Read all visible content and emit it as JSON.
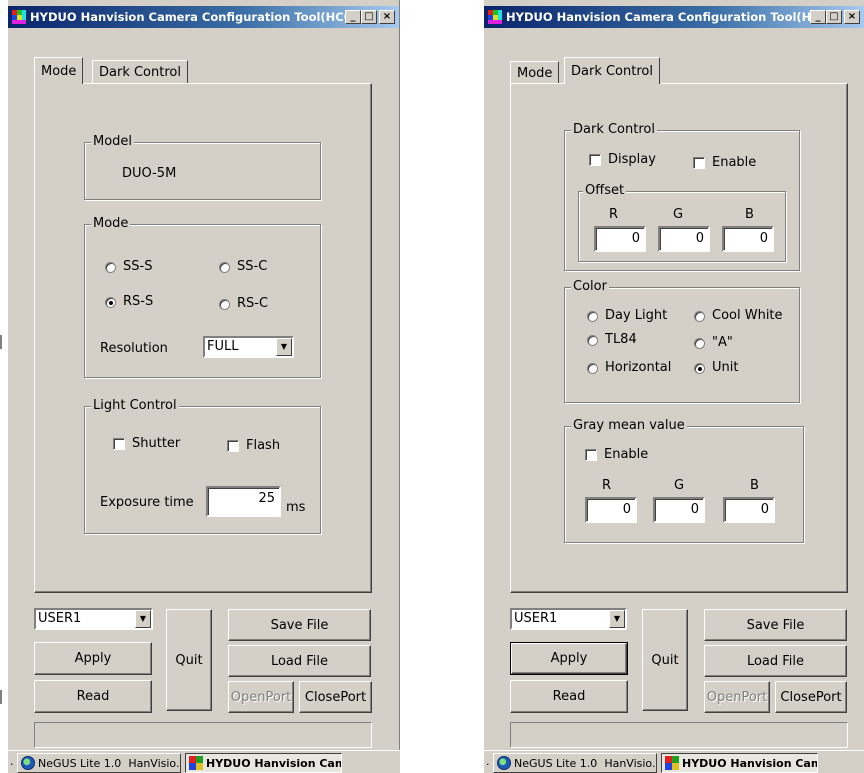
{
  "left": {
    "title": "HYDUO Hanvision Camera Configuration Tool(HCCT)",
    "tabs": [
      "Mode",
      "Dark Control"
    ],
    "model": {
      "group_title": "Model",
      "value": "DUO-5M"
    },
    "mode": {
      "group_title": "Mode",
      "options": [
        "SS-S",
        "SS-C",
        "RS-S",
        "RS-C"
      ],
      "selected": "RS-S",
      "resolution_label": "Resolution",
      "resolution_value": "FULL"
    },
    "light": {
      "group_title": "Light Control",
      "shutter_label": "Shutter",
      "flash_label": "Flash",
      "exposure_label": "Exposure time",
      "exposure_value": "25",
      "exposure_unit": "ms"
    }
  },
  "right": {
    "title": "HYDUO Hanvision Camera Configuration Tool(HCCT)",
    "tabs": [
      "Mode",
      "Dark Control"
    ],
    "dark": {
      "group_title": "Dark Control",
      "display_label": "Display",
      "enable_label": "Enable",
      "offset_title": "Offset",
      "r_label": "R",
      "g_label": "G",
      "b_label": "B",
      "r_value": "0",
      "g_value": "0",
      "b_value": "0"
    },
    "color": {
      "group_title": "Color",
      "options": [
        "Day Light",
        "Cool White",
        "TL84",
        "\"A\"",
        "Horizontal",
        "Unit"
      ],
      "selected": "Unit"
    },
    "gray": {
      "group_title": "Gray mean value",
      "enable_label": "Enable",
      "r_label": "R",
      "g_label": "G",
      "b_label": "B",
      "r_value": "0",
      "g_value": "0",
      "b_value": "0"
    }
  },
  "bottom": {
    "user_select": "USER1",
    "apply": "Apply",
    "read": "Read",
    "quit": "Quit",
    "save_file": "Save File",
    "load_file": "Load File",
    "open_port": "OpenPort",
    "close_port": "ClosePort"
  },
  "taskbar": {
    "dot": ".",
    "negus": "NeGUS Lite 1.0",
    "hanvision": "HanVisio...",
    "active_task": "HYDUO Hanvision Cam..."
  },
  "titlebar_buttons": {
    "minimize": "_",
    "maximize": "□",
    "close": "×"
  }
}
